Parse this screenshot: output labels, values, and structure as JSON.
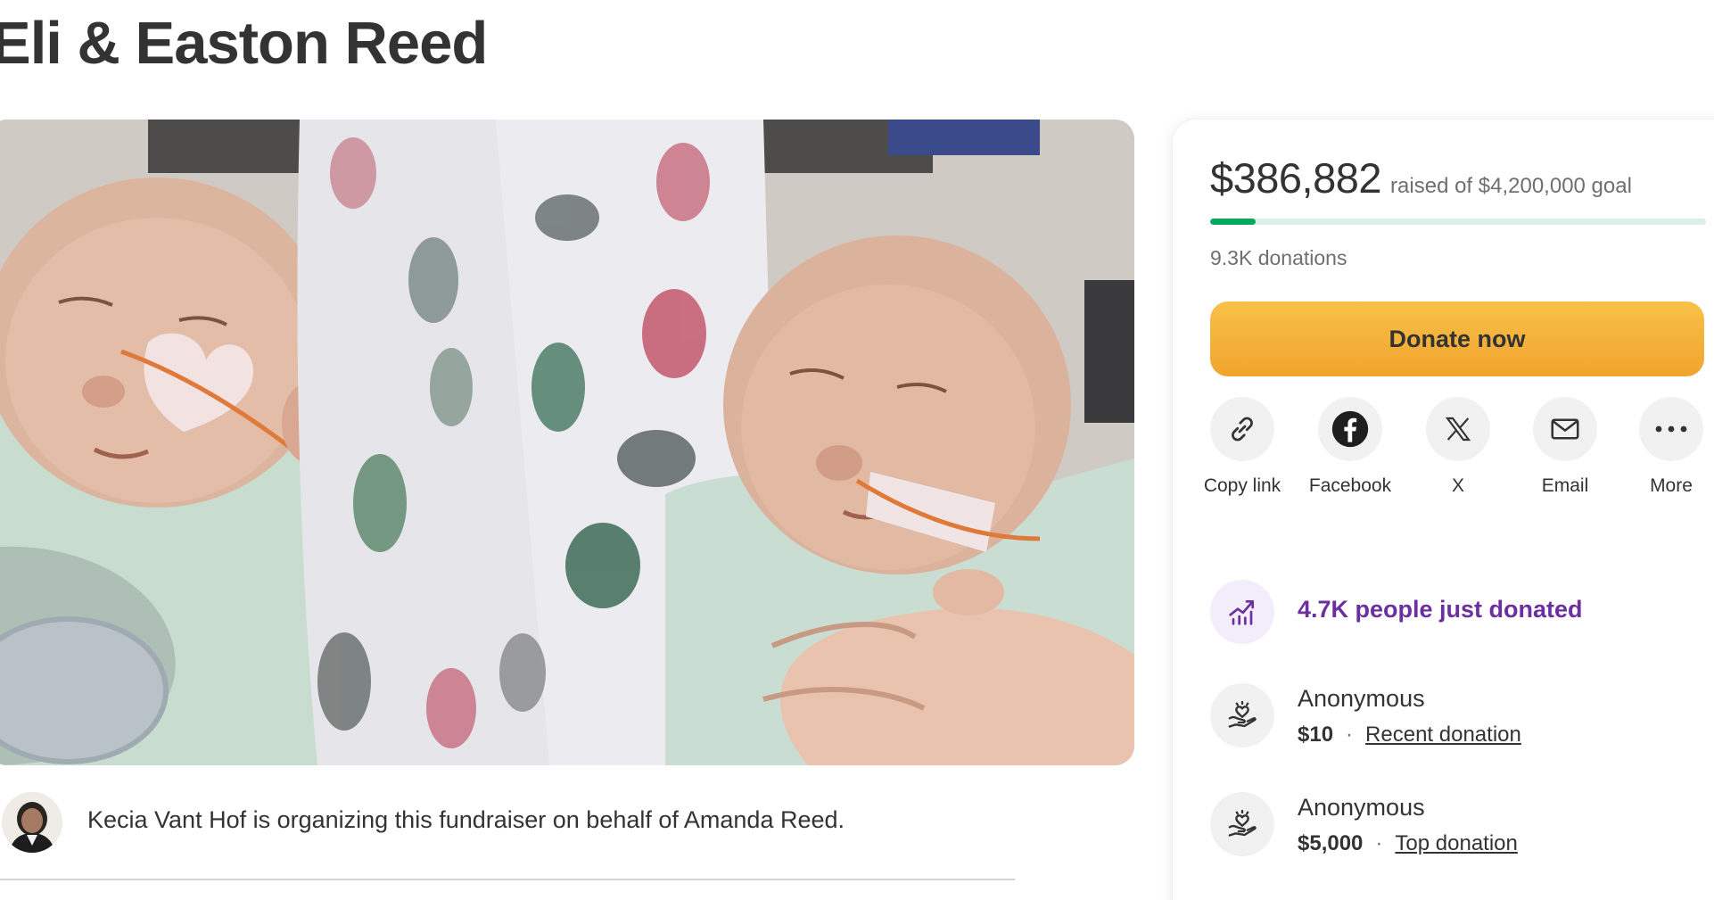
{
  "campaign": {
    "title": "Eli & Easton Reed"
  },
  "organizer": {
    "text": "Kecia Vant Hof is organizing this fundraiser on behalf of Amanda Reed."
  },
  "donation_card": {
    "raised_amount": "$386,882",
    "raised_goal_text": "raised of $4,200,000 goal",
    "progress_fraction": 0.092,
    "donations_count": "9.3K donations",
    "donate_button": "Donate now",
    "share": [
      {
        "label": "Copy link",
        "icon": "link-icon"
      },
      {
        "label": "Facebook",
        "icon": "facebook-icon"
      },
      {
        "label": "X",
        "icon": "x-logo-icon"
      },
      {
        "label": "Email",
        "icon": "mail-icon"
      },
      {
        "label": "More",
        "icon": "more-dots-icon"
      }
    ],
    "momentum_text": "4.7K people just donated",
    "donors": [
      {
        "name": "Anonymous",
        "amount": "$10",
        "tag": "Recent donation"
      },
      {
        "name": "Anonymous",
        "amount": "$5,000",
        "tag": "Top donation"
      }
    ]
  },
  "colors": {
    "progress": "#02a95c",
    "progress_track": "#dcefe6",
    "donate_button": "#f4b13b",
    "momentum_text": "#6b2fa0"
  }
}
